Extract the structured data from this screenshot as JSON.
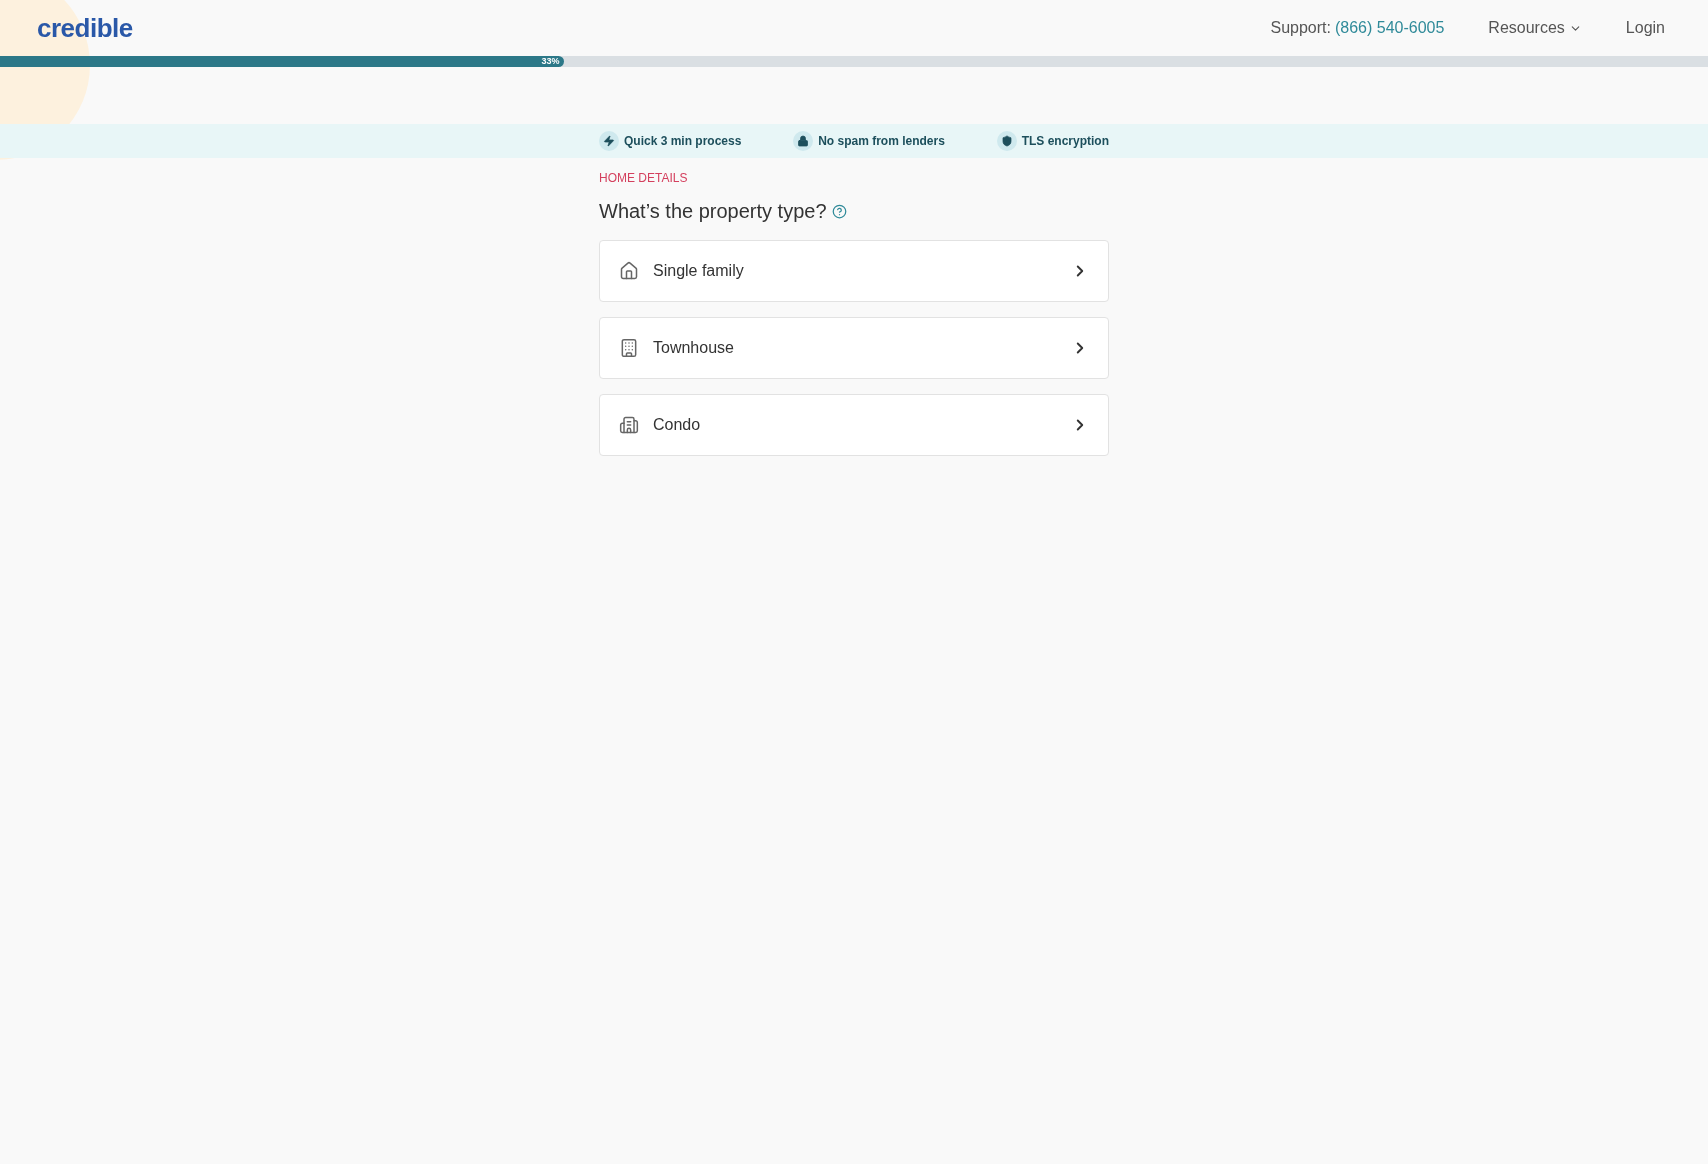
{
  "header": {
    "logo": "credible",
    "support_label": "Support:",
    "support_phone": "(866) 540-6005",
    "nav": [
      {
        "label": "Resources",
        "kind": "dropdown"
      },
      {
        "label": "Login",
        "kind": "link"
      }
    ]
  },
  "progress": {
    "level": 0.33,
    "reading": "33%"
  },
  "trust_items": [
    {
      "kind": "bolt",
      "label": "Quick 3 min process"
    },
    {
      "kind": "lock",
      "label": "No spam from lenders"
    },
    {
      "kind": "shield",
      "label": "TLS encryption"
    }
  ],
  "section_label": "HOME DETAILS",
  "question": "What’s the property type?",
  "options": [
    {
      "kind": "house",
      "label": "Single family"
    },
    {
      "kind": "townhouse",
      "label": "Townhouse"
    },
    {
      "kind": "condo",
      "label": "Condo"
    }
  ]
}
